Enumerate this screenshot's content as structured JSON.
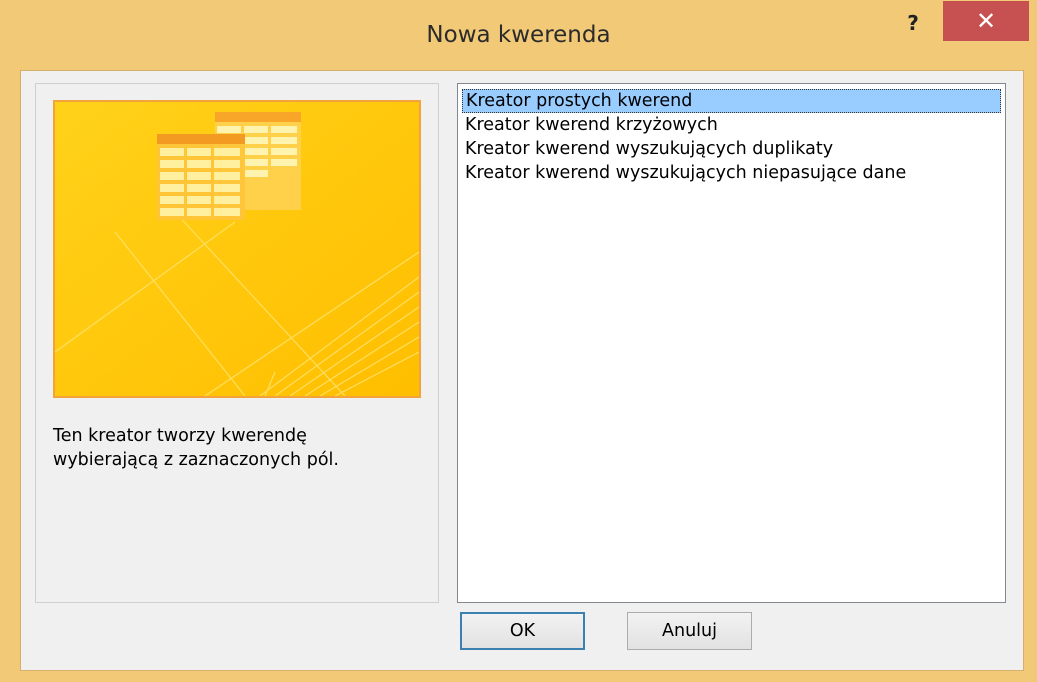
{
  "window": {
    "title": "Nowa kwerenda",
    "help_label": "?",
    "close_label": "✕"
  },
  "preview": {
    "icon": "table-wizard-illustration",
    "description_line1": "Ten kreator tworzy kwerendę",
    "description_line2": "wybierającą z zaznaczonych pól."
  },
  "wizards": {
    "items": [
      {
        "label": "Kreator prostych kwerend",
        "selected": true
      },
      {
        "label": "Kreator kwerend krzyżowych",
        "selected": false
      },
      {
        "label": "Kreator kwerend wyszukujących duplikaty",
        "selected": false
      },
      {
        "label": "Kreator kwerend wyszukujących niepasujące dane",
        "selected": false
      }
    ]
  },
  "buttons": {
    "ok_label": "OK",
    "cancel_label": "Anuluj"
  },
  "colors": {
    "frame": "#f2c977",
    "close": "#c75050",
    "selection": "#99ccff",
    "preview_border": "#f3a33a"
  }
}
